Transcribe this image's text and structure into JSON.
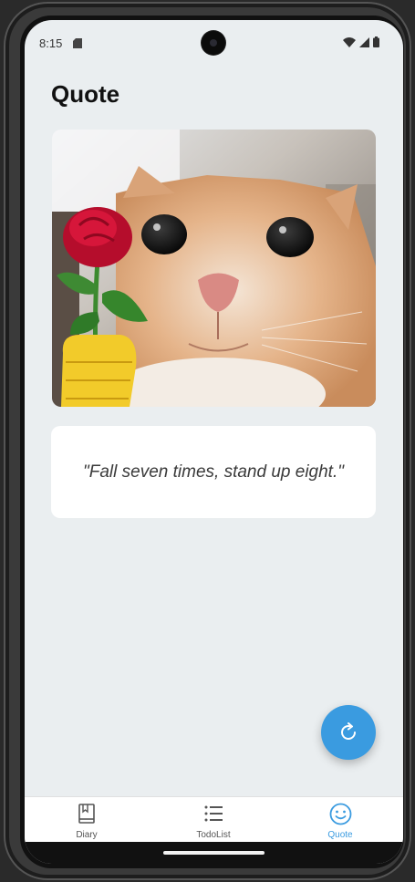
{
  "status_bar": {
    "time": "8:15"
  },
  "page": {
    "title": "Quote"
  },
  "quote": {
    "text": "\"Fall seven times, stand up eight.\""
  },
  "bottom_nav": {
    "items": [
      {
        "label": "Diary",
        "icon": "book-icon",
        "active": false
      },
      {
        "label": "TodoList",
        "icon": "list-icon",
        "active": false
      },
      {
        "label": "Quote",
        "icon": "smiley-icon",
        "active": true
      }
    ]
  },
  "colors": {
    "accent": "#3a9be0",
    "background": "#eaeef0",
    "card": "#ffffff"
  }
}
